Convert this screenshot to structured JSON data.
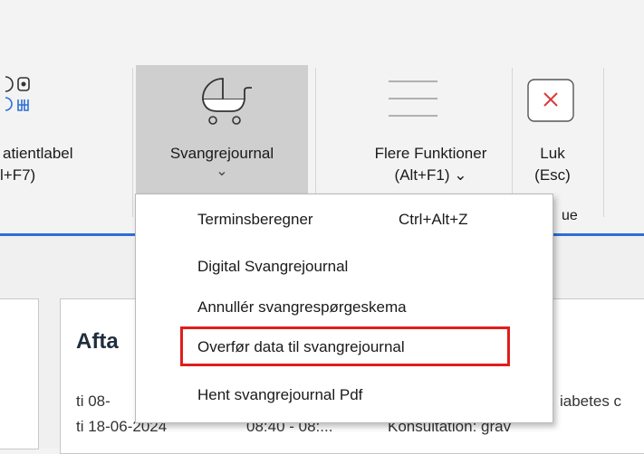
{
  "ribbon": {
    "patientlabel": {
      "line1": "atientlabel",
      "line2": "l+F7)"
    },
    "svangre": {
      "label": "Svangrejournal",
      "chevron": "⌄"
    },
    "flere": {
      "line1": "Flere Funktioner",
      "line2": "(Alt+F1) ⌄"
    },
    "luk": {
      "line1": "Luk",
      "line2": "(Esc)"
    },
    "group_fragment": "ue"
  },
  "agenda": {
    "title": "Afta",
    "rows": [
      {
        "date": "ti 08-",
        "text": "iabetes c"
      },
      {
        "date": "ti 18-06-2024",
        "time": "08:40 - 08:...",
        "text": "Konsultation: grav"
      }
    ]
  },
  "menu": {
    "items": [
      {
        "label": "Terminsberegner",
        "shortcut": "Ctrl+Alt+Z"
      },
      {
        "label": "Digital Svangrejournal"
      },
      {
        "label": "Annullér svangrespørgeskema"
      },
      {
        "label": "Overfør data til svangrejournal"
      },
      {
        "label": "Hent svangrejournal Pdf"
      }
    ]
  },
  "icons": {
    "pram": "pram-icon",
    "hamburger": "menu-lines-icon",
    "close": "close-icon"
  },
  "colors": {
    "accent": "#2b6fd6",
    "highlight": "#e11d1d",
    "close_x": "#d83b3b"
  }
}
